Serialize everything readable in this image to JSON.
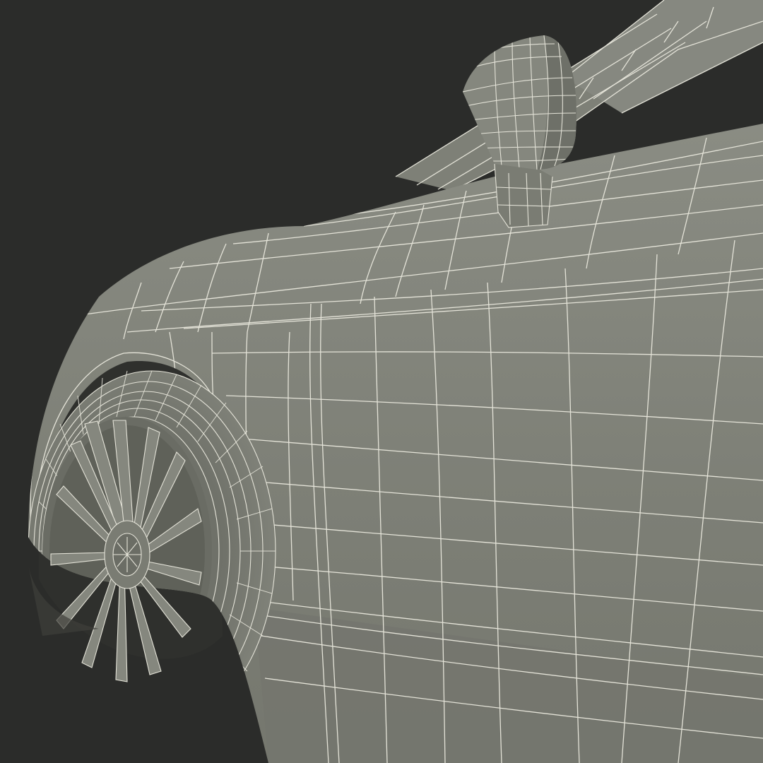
{
  "image": {
    "subject": "car-front-fender-wireframe",
    "colors": {
      "background": "#2b2c2a",
      "body": "#81837a",
      "body_shade": "#6e7068",
      "body_light": "#8e9087",
      "tire": "#7c7e75",
      "shadow": "#3e3f3b",
      "wire": "#e4e3d8"
    }
  }
}
